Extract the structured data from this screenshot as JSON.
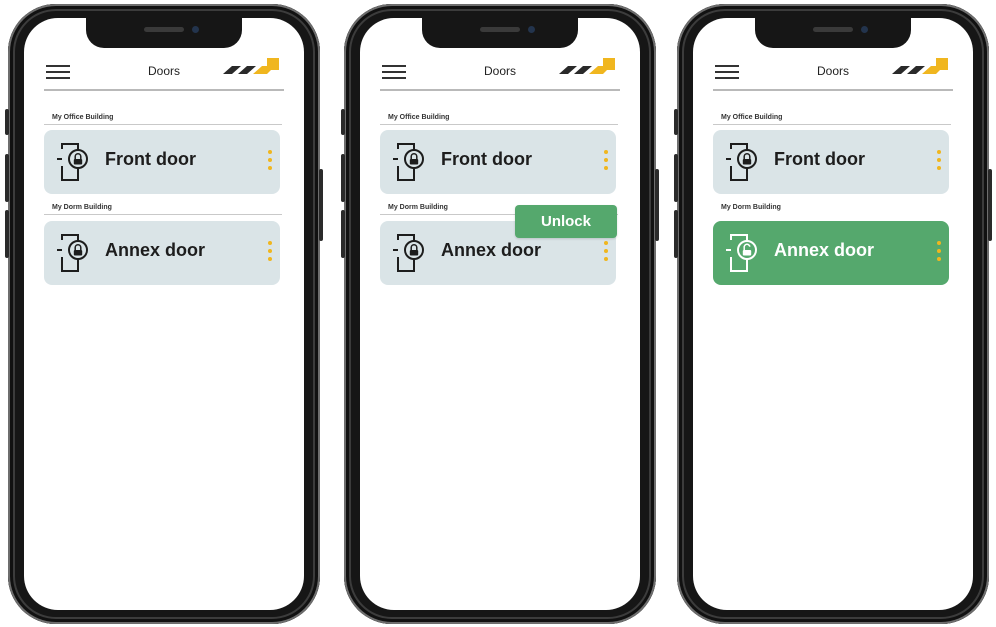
{
  "accent_color": "#f0b61f",
  "unlocked_color": "#55a86d",
  "header": {
    "title": "Doors"
  },
  "groups": {
    "office": {
      "label": "My Office Building"
    },
    "dorm": {
      "label": "My Dorm Building"
    }
  },
  "doors": {
    "front": {
      "name": "Front door",
      "icon": "locked-door-icon"
    },
    "annex": {
      "name": "Annex door",
      "icon": "locked-door-icon"
    },
    "annex_unlocked": {
      "name": "Annex door",
      "icon": "unlocked-door-icon"
    }
  },
  "unlock_button": {
    "label": "Unlock"
  }
}
